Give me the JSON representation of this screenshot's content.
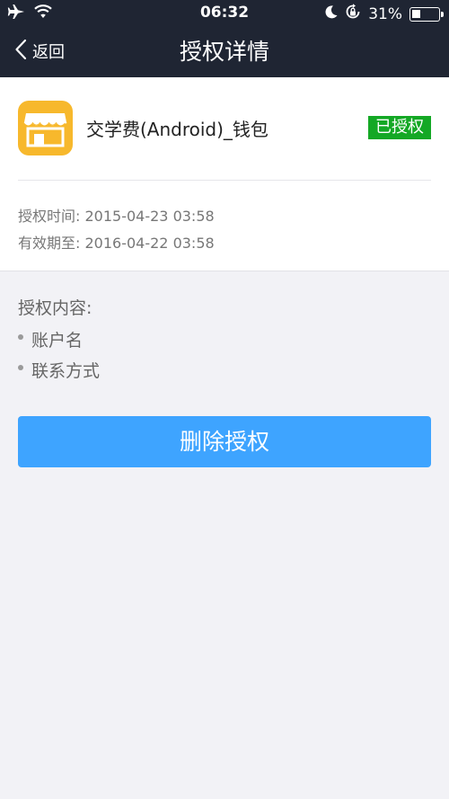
{
  "status_bar": {
    "time": "06:32",
    "battery_percent_label": "31%",
    "battery_level": 0.31,
    "icons": [
      "airplane-icon",
      "wifi-icon",
      "moon-icon",
      "rotation-lock-icon",
      "battery-icon"
    ]
  },
  "nav": {
    "back_label": "返回",
    "title": "授权详情"
  },
  "app": {
    "name": "交学费(Android)_钱包",
    "status_badge": "已授权",
    "icon": "storefront-icon",
    "icon_color": "#f7b82c",
    "badge_color": "#14a825"
  },
  "info": {
    "auth_time_label": "授权时间:",
    "auth_time_value": "2015-04-23 03:58",
    "valid_until_label": "有效期至:",
    "valid_until_value": "2016-04-22 03:58"
  },
  "content": {
    "title": "授权内容:",
    "items": [
      "账户名",
      "联系方式"
    ]
  },
  "actions": {
    "delete_label": "删除授权",
    "delete_color": "#3ea4ff"
  }
}
